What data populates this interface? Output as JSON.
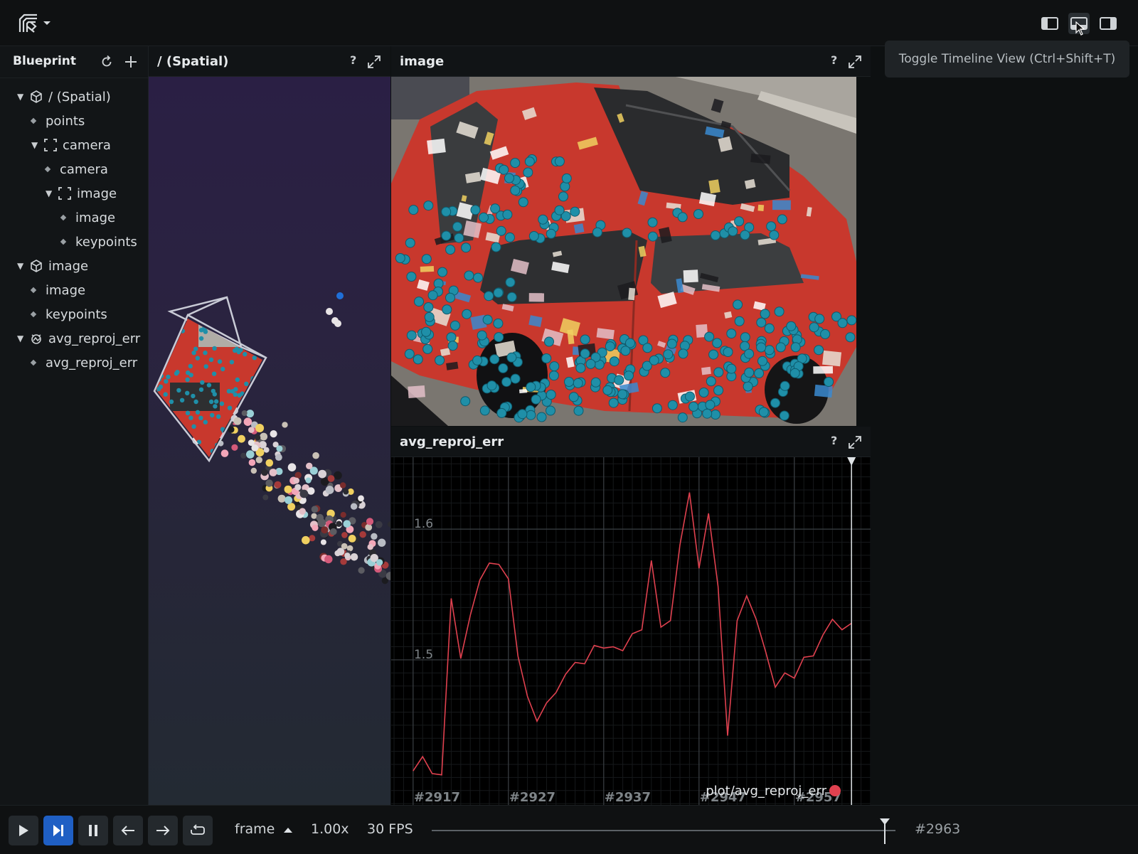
{
  "tooltip": "Toggle Timeline View (Ctrl+Shift+T)",
  "blueprint": {
    "title": "Blueprint",
    "tree": [
      {
        "label": "/ (Spatial)",
        "level": 0,
        "kind": "spatial"
      },
      {
        "label": "points",
        "level": 1,
        "kind": "entity"
      },
      {
        "label": "camera",
        "level": 1,
        "kind": "group"
      },
      {
        "label": "camera",
        "level": 2,
        "kind": "entity"
      },
      {
        "label": "image",
        "level": 2,
        "kind": "group"
      },
      {
        "label": "image",
        "level": 3,
        "kind": "entity"
      },
      {
        "label": "keypoints",
        "level": 3,
        "kind": "entity"
      },
      {
        "label": "image",
        "level": 0,
        "kind": "spatial"
      },
      {
        "label": "image",
        "level": 1,
        "kind": "entity"
      },
      {
        "label": "keypoints",
        "level": 1,
        "kind": "entity"
      },
      {
        "label": "avg_reproj_err",
        "level": 0,
        "kind": "timeseries"
      },
      {
        "label": "avg_reproj_err",
        "level": 1,
        "kind": "entity"
      }
    ]
  },
  "views": {
    "spatial": {
      "title": "/ (Spatial)",
      "help": "?"
    },
    "image": {
      "title": "image",
      "help": "?"
    },
    "plot": {
      "title": "avg_reproj_err",
      "help": "?"
    }
  },
  "chart_data": {
    "type": "line",
    "title": "",
    "xlabel": "",
    "ylabel": "",
    "series": [
      {
        "name": "plot/avg_reproj_err",
        "color": "#e0414f",
        "x": [
          2917,
          2918,
          2919,
          2920,
          2921,
          2922,
          2923,
          2924,
          2925,
          2926,
          2927,
          2928,
          2929,
          2930,
          2931,
          2932,
          2933,
          2934,
          2935,
          2936,
          2937,
          2938,
          2939,
          2940,
          2941,
          2942,
          2943,
          2944,
          2945,
          2946,
          2947,
          2948,
          2949,
          2950,
          2951,
          2952,
          2953,
          2954,
          2955,
          2956,
          2957,
          2958,
          2959,
          2960,
          2961,
          2962,
          2963
        ],
        "y": [
          1.415,
          1.426,
          1.413,
          1.412,
          1.547,
          1.501,
          1.534,
          1.561,
          1.574,
          1.573,
          1.562,
          1.503,
          1.472,
          1.453,
          1.467,
          1.475,
          1.489,
          1.498,
          1.497,
          1.511,
          1.509,
          1.51,
          1.507,
          1.52,
          1.523,
          1.576,
          1.525,
          1.53,
          1.588,
          1.628,
          1.57,
          1.612,
          1.556,
          1.442,
          1.53,
          1.549,
          1.531,
          1.506,
          1.479,
          1.49,
          1.486,
          1.502,
          1.503,
          1.519,
          1.531,
          1.523,
          1.528
        ]
      }
    ],
    "x_ticks": [
      "#2917",
      "#2927",
      "#2937",
      "#2947",
      "#2957"
    ],
    "y_ticks": [
      "1.6",
      "1.5"
    ],
    "xlim": [
      2914.7,
      2965
    ],
    "ylim": [
      1.389,
      1.655
    ],
    "current_frame": 2963,
    "grid": true,
    "legend": "bottom-right"
  },
  "timeline": {
    "timeline_name": "frame",
    "speed": "1.00x",
    "fps": "30 FPS",
    "current": "#2963",
    "progress": 0.977
  },
  "icons": [
    "logo-icon",
    "left-panel-icon",
    "bottom-panel-icon",
    "right-panel-icon",
    "reset-icon",
    "add-icon",
    "help-icon",
    "maximize-icon",
    "play-icon",
    "step-end-icon",
    "pause-icon",
    "arrow-left-icon",
    "arrow-right-icon",
    "loop-icon"
  ]
}
